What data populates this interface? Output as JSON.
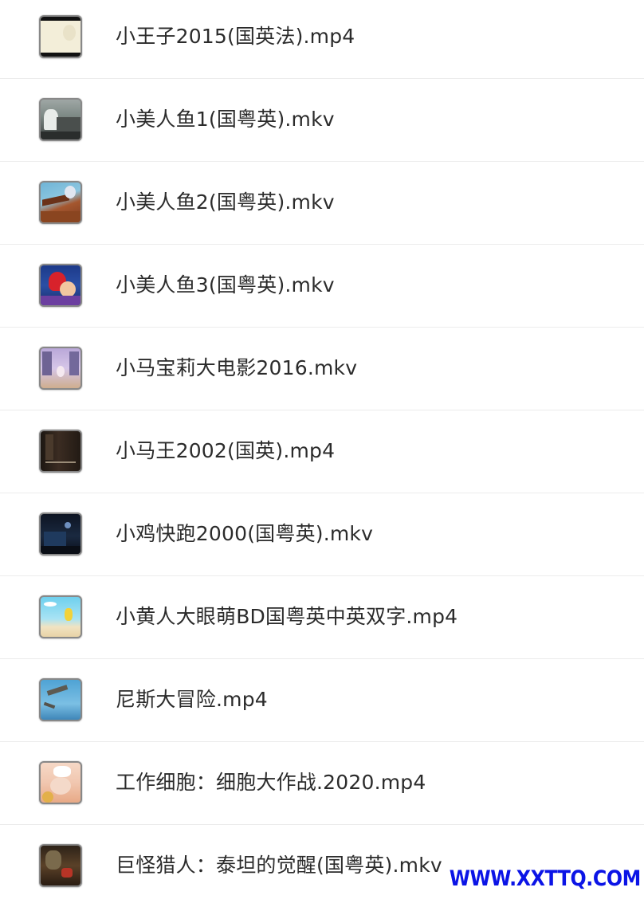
{
  "files": [
    {
      "name": "小王子2015(国英法).mp4",
      "thumbnail": "video-thumbnail"
    },
    {
      "name": "小美人鱼1(国粤英).mkv",
      "thumbnail": "video-thumbnail"
    },
    {
      "name": "小美人鱼2(国粤英).mkv",
      "thumbnail": "video-thumbnail"
    },
    {
      "name": "小美人鱼3(国粤英).mkv",
      "thumbnail": "video-thumbnail"
    },
    {
      "name": "小马宝莉大电影2016.mkv",
      "thumbnail": "video-thumbnail"
    },
    {
      "name": "小马王2002(国英).mp4",
      "thumbnail": "video-thumbnail"
    },
    {
      "name": "小鸡快跑2000(国粤英).mkv",
      "thumbnail": "video-thumbnail"
    },
    {
      "name": "小黄人大眼萌BD国粤英中英双字.mp4",
      "thumbnail": "video-thumbnail"
    },
    {
      "name": "尼斯大冒险.mp4",
      "thumbnail": "video-thumbnail"
    },
    {
      "name": "工作细胞：细胞大作战.2020.mp4",
      "thumbnail": "video-thumbnail"
    },
    {
      "name": "巨怪猎人：泰坦的觉醒(国粤英).mkv",
      "thumbnail": "video-thumbnail"
    }
  ],
  "watermark": "WWW.XXTTQ.COM",
  "colors": {
    "text": "#2b2b2b",
    "divider": "#ececec",
    "watermark": "#0b14e6"
  }
}
